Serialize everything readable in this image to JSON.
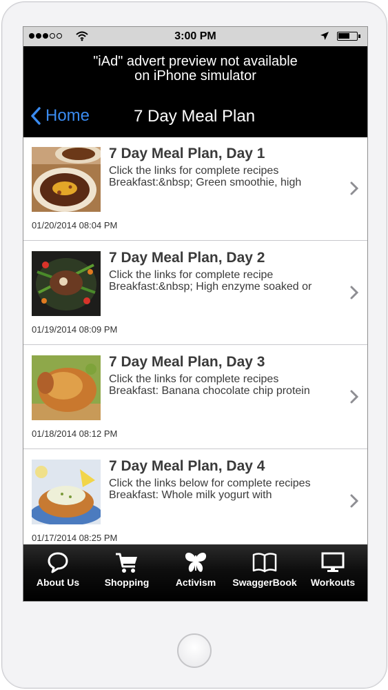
{
  "status_bar": {
    "time": "3:00 PM",
    "signal_bars": 3,
    "signal_total": 5
  },
  "ad": {
    "line1": "\"iAd\" advert preview not available",
    "line2": "on iPhone simulator"
  },
  "nav": {
    "back_label": "Home",
    "title": "7 Day Meal Plan"
  },
  "items": [
    {
      "title": "7 Day Meal Plan, Day 1",
      "line1": "Click the links for complete recipes",
      "line2": "Breakfast:&nbsp; Green smoothie, high",
      "date": "01/20/2014 08:04 PM",
      "image": "chili-bowl-photo"
    },
    {
      "title": "7 Day Meal Plan, Day 2",
      "line1": "Click the links for complete recipe",
      "line2": "Breakfast:&nbsp; High enzyme soaked or",
      "date": "01/19/2014 08:09 PM",
      "image": "steak-vegetables-photo"
    },
    {
      "title": "7 Day Meal Plan, Day 3",
      "line1": "Click the links for complete recipes",
      "line2": "Breakfast: Banana chocolate chip protein",
      "date": "01/18/2014 08:12 PM",
      "image": "roast-chicken-photo"
    },
    {
      "title": "7 Day Meal Plan, Day 4",
      "line1": "Click the links below for complete recipes",
      "line2": "Breakfast: Whole milk yogurt with",
      "date": "01/17/2014 08:25 PM",
      "image": "fish-cutlet-photo"
    }
  ],
  "tabs": [
    {
      "label": "About Us",
      "icon": "speech-bubble-icon"
    },
    {
      "label": "Shopping",
      "icon": "shopping-cart-icon"
    },
    {
      "label": "Activism",
      "icon": "butterfly-icon"
    },
    {
      "label": "SwaggerBook",
      "icon": "open-book-icon"
    },
    {
      "label": "Workouts",
      "icon": "monitor-icon"
    }
  ],
  "colors": {
    "accent": "#3a8bf0",
    "bar": "#000000",
    "status": "#d6d6d6"
  }
}
